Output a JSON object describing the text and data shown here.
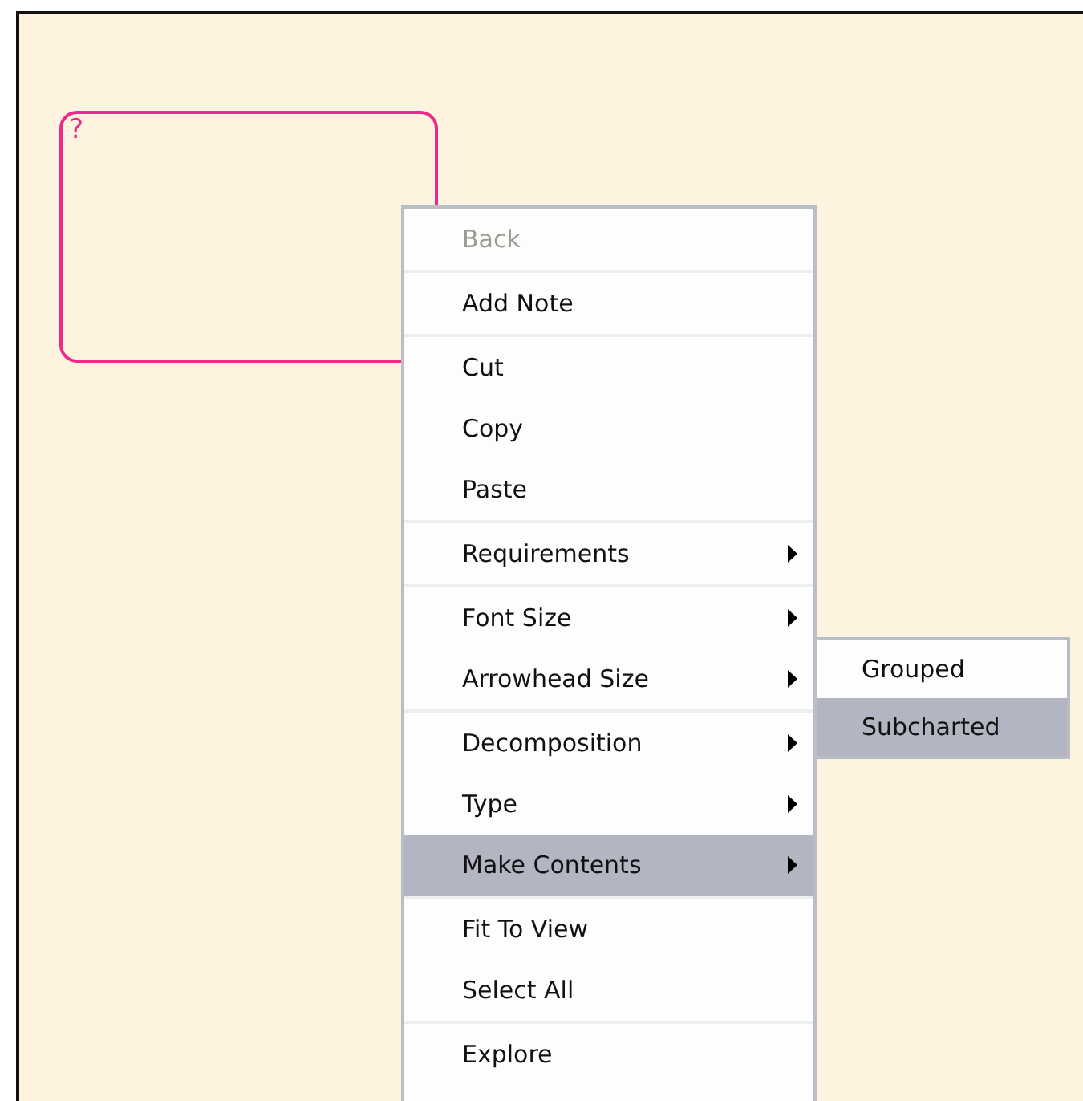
{
  "canvas": {
    "state_box": {
      "label": "?"
    }
  },
  "context_menu": {
    "groups": [
      [
        {
          "label": "Back",
          "disabled": true,
          "has_submenu": false,
          "selected": false
        }
      ],
      [
        {
          "label": "Add Note",
          "disabled": false,
          "has_submenu": false,
          "selected": false
        }
      ],
      [
        {
          "label": "Cut",
          "disabled": false,
          "has_submenu": false,
          "selected": false
        },
        {
          "label": "Copy",
          "disabled": false,
          "has_submenu": false,
          "selected": false
        },
        {
          "label": "Paste",
          "disabled": false,
          "has_submenu": false,
          "selected": false
        }
      ],
      [
        {
          "label": "Requirements",
          "disabled": false,
          "has_submenu": true,
          "selected": false
        }
      ],
      [
        {
          "label": "Font Size",
          "disabled": false,
          "has_submenu": true,
          "selected": false
        },
        {
          "label": "Arrowhead Size",
          "disabled": false,
          "has_submenu": true,
          "selected": false
        }
      ],
      [
        {
          "label": "Decomposition",
          "disabled": false,
          "has_submenu": true,
          "selected": false
        },
        {
          "label": "Type",
          "disabled": false,
          "has_submenu": true,
          "selected": false
        },
        {
          "label": "Make Contents",
          "disabled": false,
          "has_submenu": true,
          "selected": true
        }
      ],
      [
        {
          "label": "Fit To View",
          "disabled": false,
          "has_submenu": false,
          "selected": false
        },
        {
          "label": "Select All",
          "disabled": false,
          "has_submenu": false,
          "selected": false
        }
      ],
      [
        {
          "label": "Explore",
          "disabled": false,
          "has_submenu": false,
          "selected": false
        }
      ]
    ]
  },
  "submenu": {
    "items": [
      {
        "label": "Grouped",
        "selected": false
      },
      {
        "label": "Subcharted",
        "selected": true
      }
    ]
  }
}
